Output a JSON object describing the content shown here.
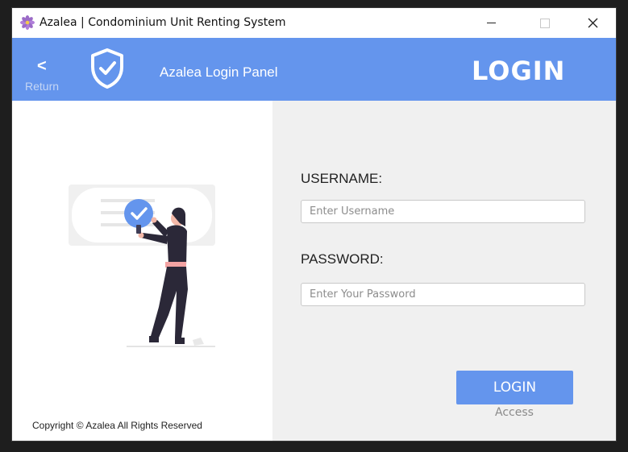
{
  "window": {
    "title": "Azalea | Condominium Unit Renting System",
    "app_icon": "flower-icon",
    "controls": [
      "minimize-icon",
      "maximize-icon",
      "close-icon"
    ],
    "close_glyph": "✕"
  },
  "header": {
    "back_glyph": "<",
    "back_label": "Return",
    "shield_icon": "shield-check-icon",
    "panel_title": "Azalea Login Panel",
    "page_heading": "LOGIN",
    "background_color": "#6495ed"
  },
  "left_panel": {
    "illustration": "person-verified-illustration",
    "copyright": "Copyright © Azalea All Rights Reserved"
  },
  "form": {
    "username_label": "USERNAME:",
    "username_placeholder": "Enter Username",
    "username_value": "",
    "password_label": "PASSWORD:",
    "password_placeholder": "Enter Your Password",
    "password_value": "",
    "login_button": "LOGIN",
    "access_label": "Access",
    "accent_color": "#6495ed",
    "background_color": "#f0f0f0"
  }
}
